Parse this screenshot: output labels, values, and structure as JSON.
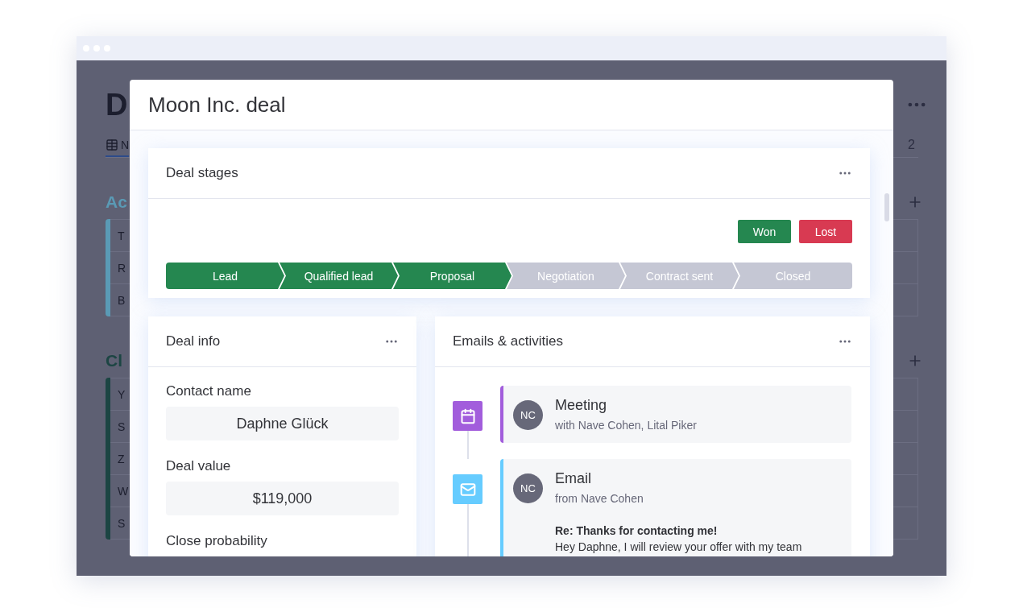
{
  "background": {
    "title": "D",
    "tab": "N",
    "tab_count": "2",
    "groups": [
      {
        "title": "Ac",
        "color": "#5a9ab5",
        "rows": [
          "T",
          "R",
          "B"
        ]
      },
      {
        "title": "Cl",
        "color": "#1c4543",
        "rows": [
          "Y",
          "S",
          "Z",
          "W",
          "S"
        ]
      }
    ]
  },
  "modal": {
    "title": "Moon Inc. deal",
    "deal_stages": {
      "title": "Deal stages",
      "won": "Won",
      "lost": "Lost",
      "stages": [
        {
          "label": "Lead",
          "completed": true
        },
        {
          "label": "Qualified lead",
          "completed": true
        },
        {
          "label": "Proposal",
          "completed": true
        },
        {
          "label": "Negotiation",
          "completed": false
        },
        {
          "label": "Contract sent",
          "completed": false
        },
        {
          "label": "Closed",
          "completed": false
        }
      ]
    },
    "deal_info": {
      "title": "Deal info",
      "fields": [
        {
          "label": "Contact name",
          "value": "Daphne Glück"
        },
        {
          "label": "Deal value",
          "value": "$119,000"
        },
        {
          "label": "Close probability"
        }
      ]
    },
    "activities": {
      "title": "Emails & activities",
      "items": [
        {
          "kind": "meeting",
          "color": "#a25ddc",
          "avatar": "NC",
          "title": "Meeting",
          "subtitle": "with Nave Cohen, Lital Piker"
        },
        {
          "kind": "email",
          "color": "#66ccff",
          "avatar": "NC",
          "title": "Email",
          "subtitle": "from Nave Cohen",
          "subject": "Re: Thanks for contacting me!",
          "body": "Hey Daphne, I will review your offer with my team"
        }
      ]
    }
  }
}
